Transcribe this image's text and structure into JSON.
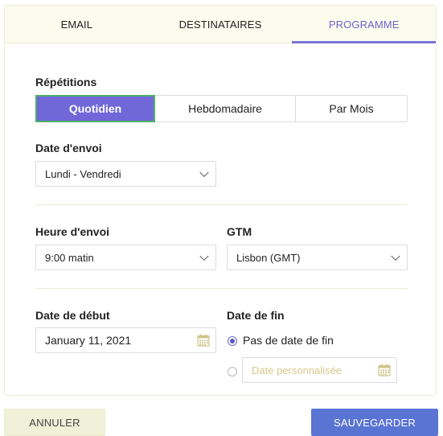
{
  "tabs": [
    {
      "label": "EMAIL",
      "active": false
    },
    {
      "label": "DESTINATAIRES",
      "active": false
    },
    {
      "label": "PROGRAMME",
      "active": true
    }
  ],
  "repetitions": {
    "label": "Répétitions",
    "options": [
      "Quotidien",
      "Hebdomadaire",
      "Par Mois"
    ],
    "selected": "Quotidien"
  },
  "send_date": {
    "label": "Date d'envoi",
    "value": "Lundi - Vendredi"
  },
  "send_time": {
    "label": "Heure d'envoi",
    "value": "9:00 matin"
  },
  "timezone": {
    "label": "GTM",
    "value": "Lisbon (GMT)"
  },
  "start_date": {
    "label": "Date de début",
    "value": "January 11, 2021"
  },
  "end_date": {
    "label": "Date de fin",
    "no_end_label": "Pas de date de fin",
    "custom_placeholder": "Date personnalisée",
    "selected": "no_end"
  },
  "actions": {
    "cancel_label": "ANNULER",
    "save_label": "SAUVEGARDER"
  },
  "colors": {
    "accent": "#7068d9",
    "save": "#5a74d4",
    "cancel_bg": "#f1f0d8",
    "tabs_bg": "#fbfbee"
  }
}
